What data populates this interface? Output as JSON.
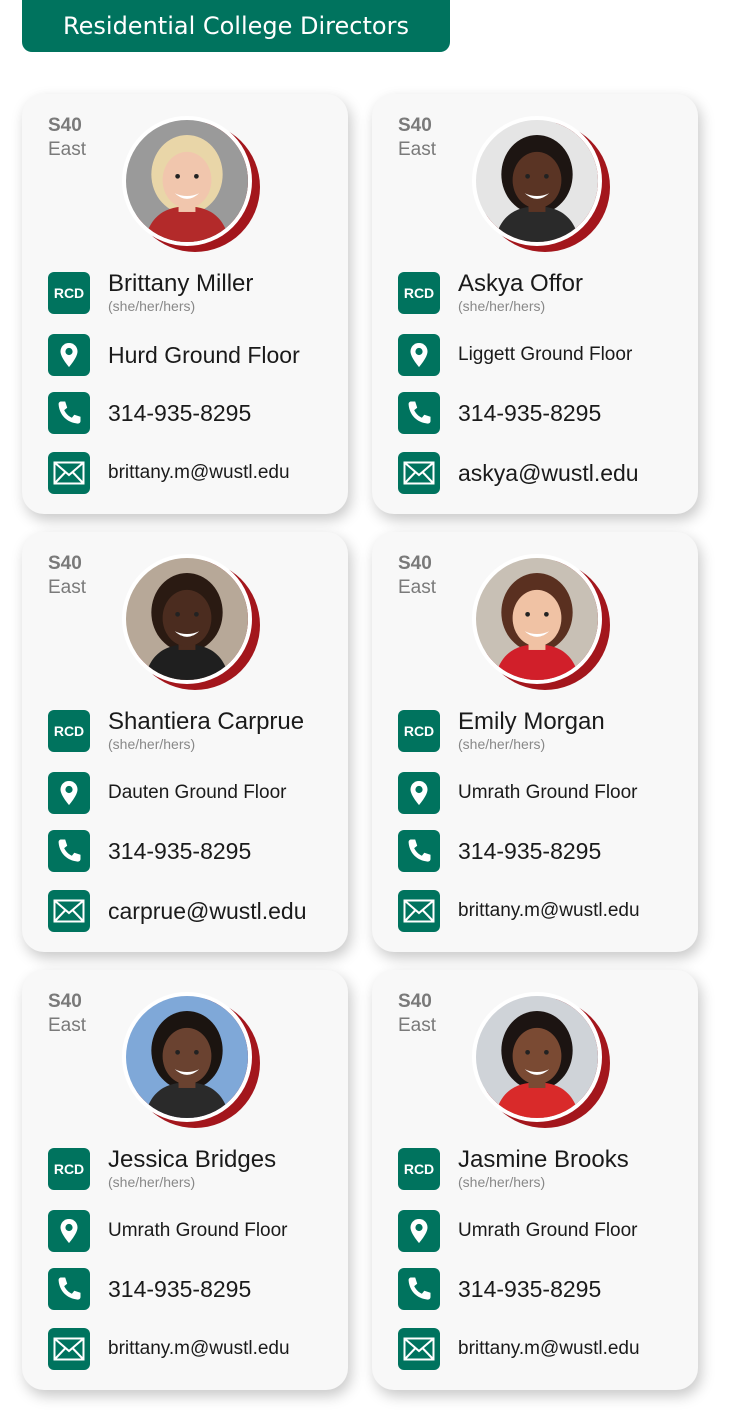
{
  "header": {
    "title": "Residential College Directors"
  },
  "cards": [
    {
      "building_code": "S40",
      "building_area": "East",
      "badge": "RCD",
      "name": "Brittany Miller",
      "pronouns": "(she/her/hers)",
      "location": "Hurd Ground Floor",
      "phone": "314-935-8295",
      "email": "brittany.m@wustl.edu"
    },
    {
      "building_code": "S40",
      "building_area": "East",
      "badge": "RCD",
      "name": "Askya Offor",
      "pronouns": "(she/her/hers)",
      "location": "Liggett Ground Floor",
      "phone": "314-935-8295",
      "email": "askya@wustl.edu"
    },
    {
      "building_code": "S40",
      "building_area": "East",
      "badge": "RCD",
      "name": "Shantiera Carprue",
      "pronouns": "(she/her/hers)",
      "location": "Dauten Ground Floor",
      "phone": "314-935-8295",
      "email": "carprue@wustl.edu"
    },
    {
      "building_code": "S40",
      "building_area": "East",
      "badge": "RCD",
      "name": "Emily Morgan",
      "pronouns": "(she/her/hers)",
      "location": "Umrath Ground Floor",
      "phone": "314-935-8295",
      "email": "brittany.m@wustl.edu"
    },
    {
      "building_code": "S40",
      "building_area": "East",
      "badge": "RCD",
      "name": "Jessica Bridges",
      "pronouns": "(she/her/hers)",
      "location": "Umrath Ground Floor",
      "phone": "314-935-8295",
      "email": "brittany.m@wustl.edu"
    },
    {
      "building_code": "S40",
      "building_area": "East",
      "badge": "RCD",
      "name": "Jasmine Brooks",
      "pronouns": "(she/her/hers)",
      "location": "Umrath Ground Floor",
      "phone": "314-935-8295",
      "email": "brittany.m@wustl.edu"
    }
  ],
  "icons": {
    "location": "map-pin-icon",
    "phone": "phone-icon",
    "email": "envelope-icon"
  },
  "colors": {
    "brand_green": "#00735e",
    "photo_accent_red": "#a3161c",
    "card_bg": "#f8f8f8"
  }
}
